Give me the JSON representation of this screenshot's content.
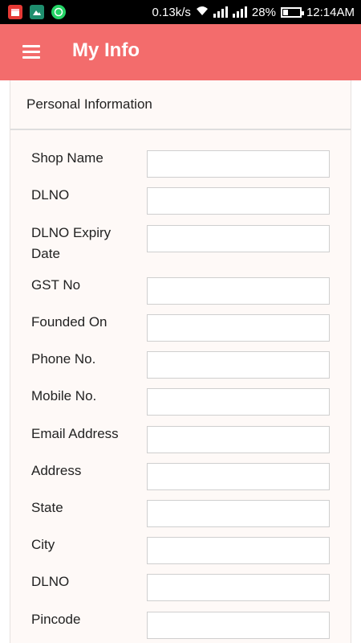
{
  "status_bar": {
    "speed": "0.13k/s",
    "battery_text": "28%",
    "battery_level": 0.28,
    "time": "12:14AM",
    "icons": [
      "calendar-icon",
      "gallery-icon",
      "whatsapp-icon",
      "wifi-icon",
      "signal-icon",
      "battery-icon"
    ]
  },
  "app_bar": {
    "title": "My Info",
    "menu_icon": "hamburger-menu-icon",
    "color": "#f36c6c"
  },
  "card": {
    "title": "Personal Information"
  },
  "form": {
    "fields": [
      {
        "label": "Shop Name",
        "value": ""
      },
      {
        "label": "DLNO",
        "value": ""
      },
      {
        "label": "DLNO Expiry Date",
        "value": ""
      },
      {
        "label": "GST No",
        "value": ""
      },
      {
        "label": "Founded On",
        "value": ""
      },
      {
        "label": "Phone No.",
        "value": ""
      },
      {
        "label": "Mobile No.",
        "value": ""
      },
      {
        "label": "Email Address",
        "value": ""
      },
      {
        "label": "Address",
        "value": ""
      },
      {
        "label": "State",
        "value": ""
      },
      {
        "label": "City",
        "value": ""
      },
      {
        "label": "DLNO",
        "value": ""
      },
      {
        "label": "Pincode",
        "value": ""
      }
    ]
  }
}
